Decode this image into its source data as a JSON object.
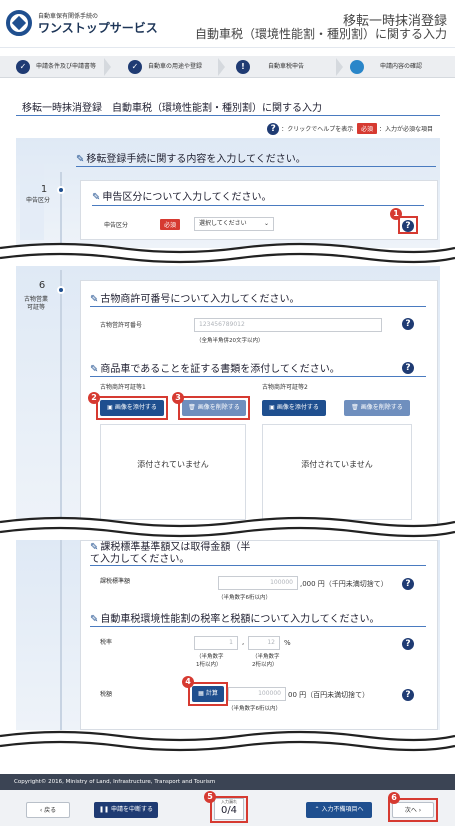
{
  "header": {
    "logo_sub": "自動車保有関係手続の",
    "logo_main": "ワンストップサービス",
    "title_line1": "移転一時抹消登録",
    "title_line2": "自動車税（環境性能割・種別割）に関する入力"
  },
  "steps": [
    {
      "num": "",
      "label": "申請条件及び申請書等"
    },
    {
      "num": "",
      "label": "自動車の用途や登録"
    },
    {
      "num": "!",
      "label": "自動車税申告"
    },
    {
      "num": "",
      "label": "申請内容の確認"
    }
  ],
  "page_title": "移転一時抹消登録　自動車税（環境性能割・種別割）に関する入力",
  "help_legend": {
    "icon": "?",
    "help_text": "：クリックでヘルプを表示",
    "required_tag": "必須",
    "required_text": "：入力が必須な項目"
  },
  "section_main_heading": "移転登録手続に関する内容を入力してください。",
  "step1": {
    "num": "1",
    "label": "申告区分"
  },
  "declaration": {
    "heading": "申告区分について入力してください。",
    "field_label": "申告区分",
    "required_tag": "必須",
    "select_value": "選択してください"
  },
  "step6": {
    "num": "6",
    "label_line1": "古物営業",
    "label_line2": "可証等"
  },
  "antique": {
    "heading": "古物商許可番号について入力してください。",
    "field_label": "古物営許可番号",
    "placeholder": "123456789012",
    "note": "（全角半角併20文字以内）"
  },
  "proof": {
    "heading": "商品車であることを証する書類を添付してください。",
    "col1_label": "古物商許可証等1",
    "col2_label": "古物商許可証等2",
    "add_label": "画像を添付する",
    "delete_label": "画像を削除する",
    "empty_text": "添付されていません"
  },
  "tax_base": {
    "heading_part": "課税標準基準額又は取得金額（半",
    "heading_line2": "て入力してください。",
    "field_label": "課税標準額",
    "placeholder": "100000",
    "unit": ",000 円（千円未満切捨て）",
    "note": "（半角数字6桁以内）"
  },
  "tax_rate": {
    "heading": "自動車税環境性能割の税率と税額について入力してください。",
    "rate_label": "税率",
    "rate_int": "1",
    "rate_dec": "12",
    "rate_unit": "%",
    "note1_line1": "（半角数字",
    "note1_line2": "1桁以内）",
    "note2_line1": "（半角数字",
    "note2_line2": "2桁以内）",
    "amount_label": "税額",
    "calc_label": "計算",
    "amount_placeholder": "100000",
    "amount_unit": "00 円（百円未満切捨て）",
    "amount_note": "（半角数字6桁以内）"
  },
  "callouts": [
    "1",
    "2",
    "3",
    "4",
    "5",
    "6"
  ],
  "footer": {
    "copyright": "Copyright© 2016, Ministry of Land, Infrastructure, Transport and Tourism"
  },
  "bottom": {
    "back": "‹  戻る",
    "cancel": "申請を中断する",
    "counter_label": "入力漏れ",
    "counter_value": "0/4",
    "unentered": "入力不備項目へ",
    "next": "次へ  ›"
  },
  "colors": {
    "accent": "#1f4f8f",
    "highlight": "#d63a31",
    "footer": "#3b4454"
  }
}
